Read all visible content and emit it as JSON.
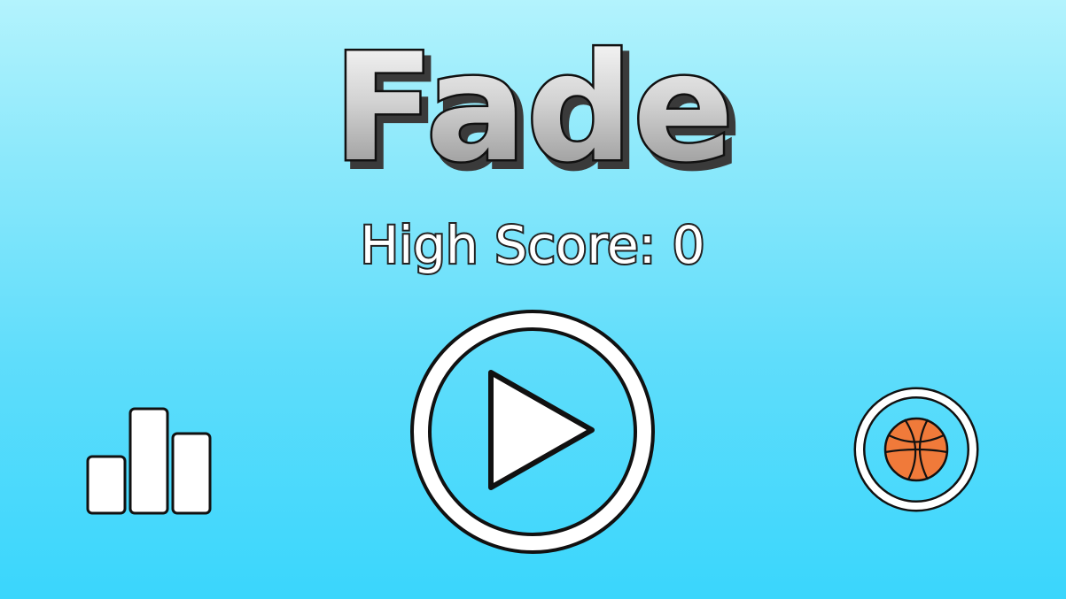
{
  "game": {
    "title": "Fade",
    "high_score_label": "High Score: 0"
  },
  "buttons": {
    "play": {
      "icon": "play-icon"
    },
    "leaderboard": {
      "icon": "bar-chart-icon"
    },
    "skins": {
      "icon": "basketball-icon"
    }
  },
  "colors": {
    "sky_top": "#b3f3fd",
    "sky_bottom": "#3ad6fc",
    "outline": "#111111",
    "ball": "#f07a3a"
  }
}
